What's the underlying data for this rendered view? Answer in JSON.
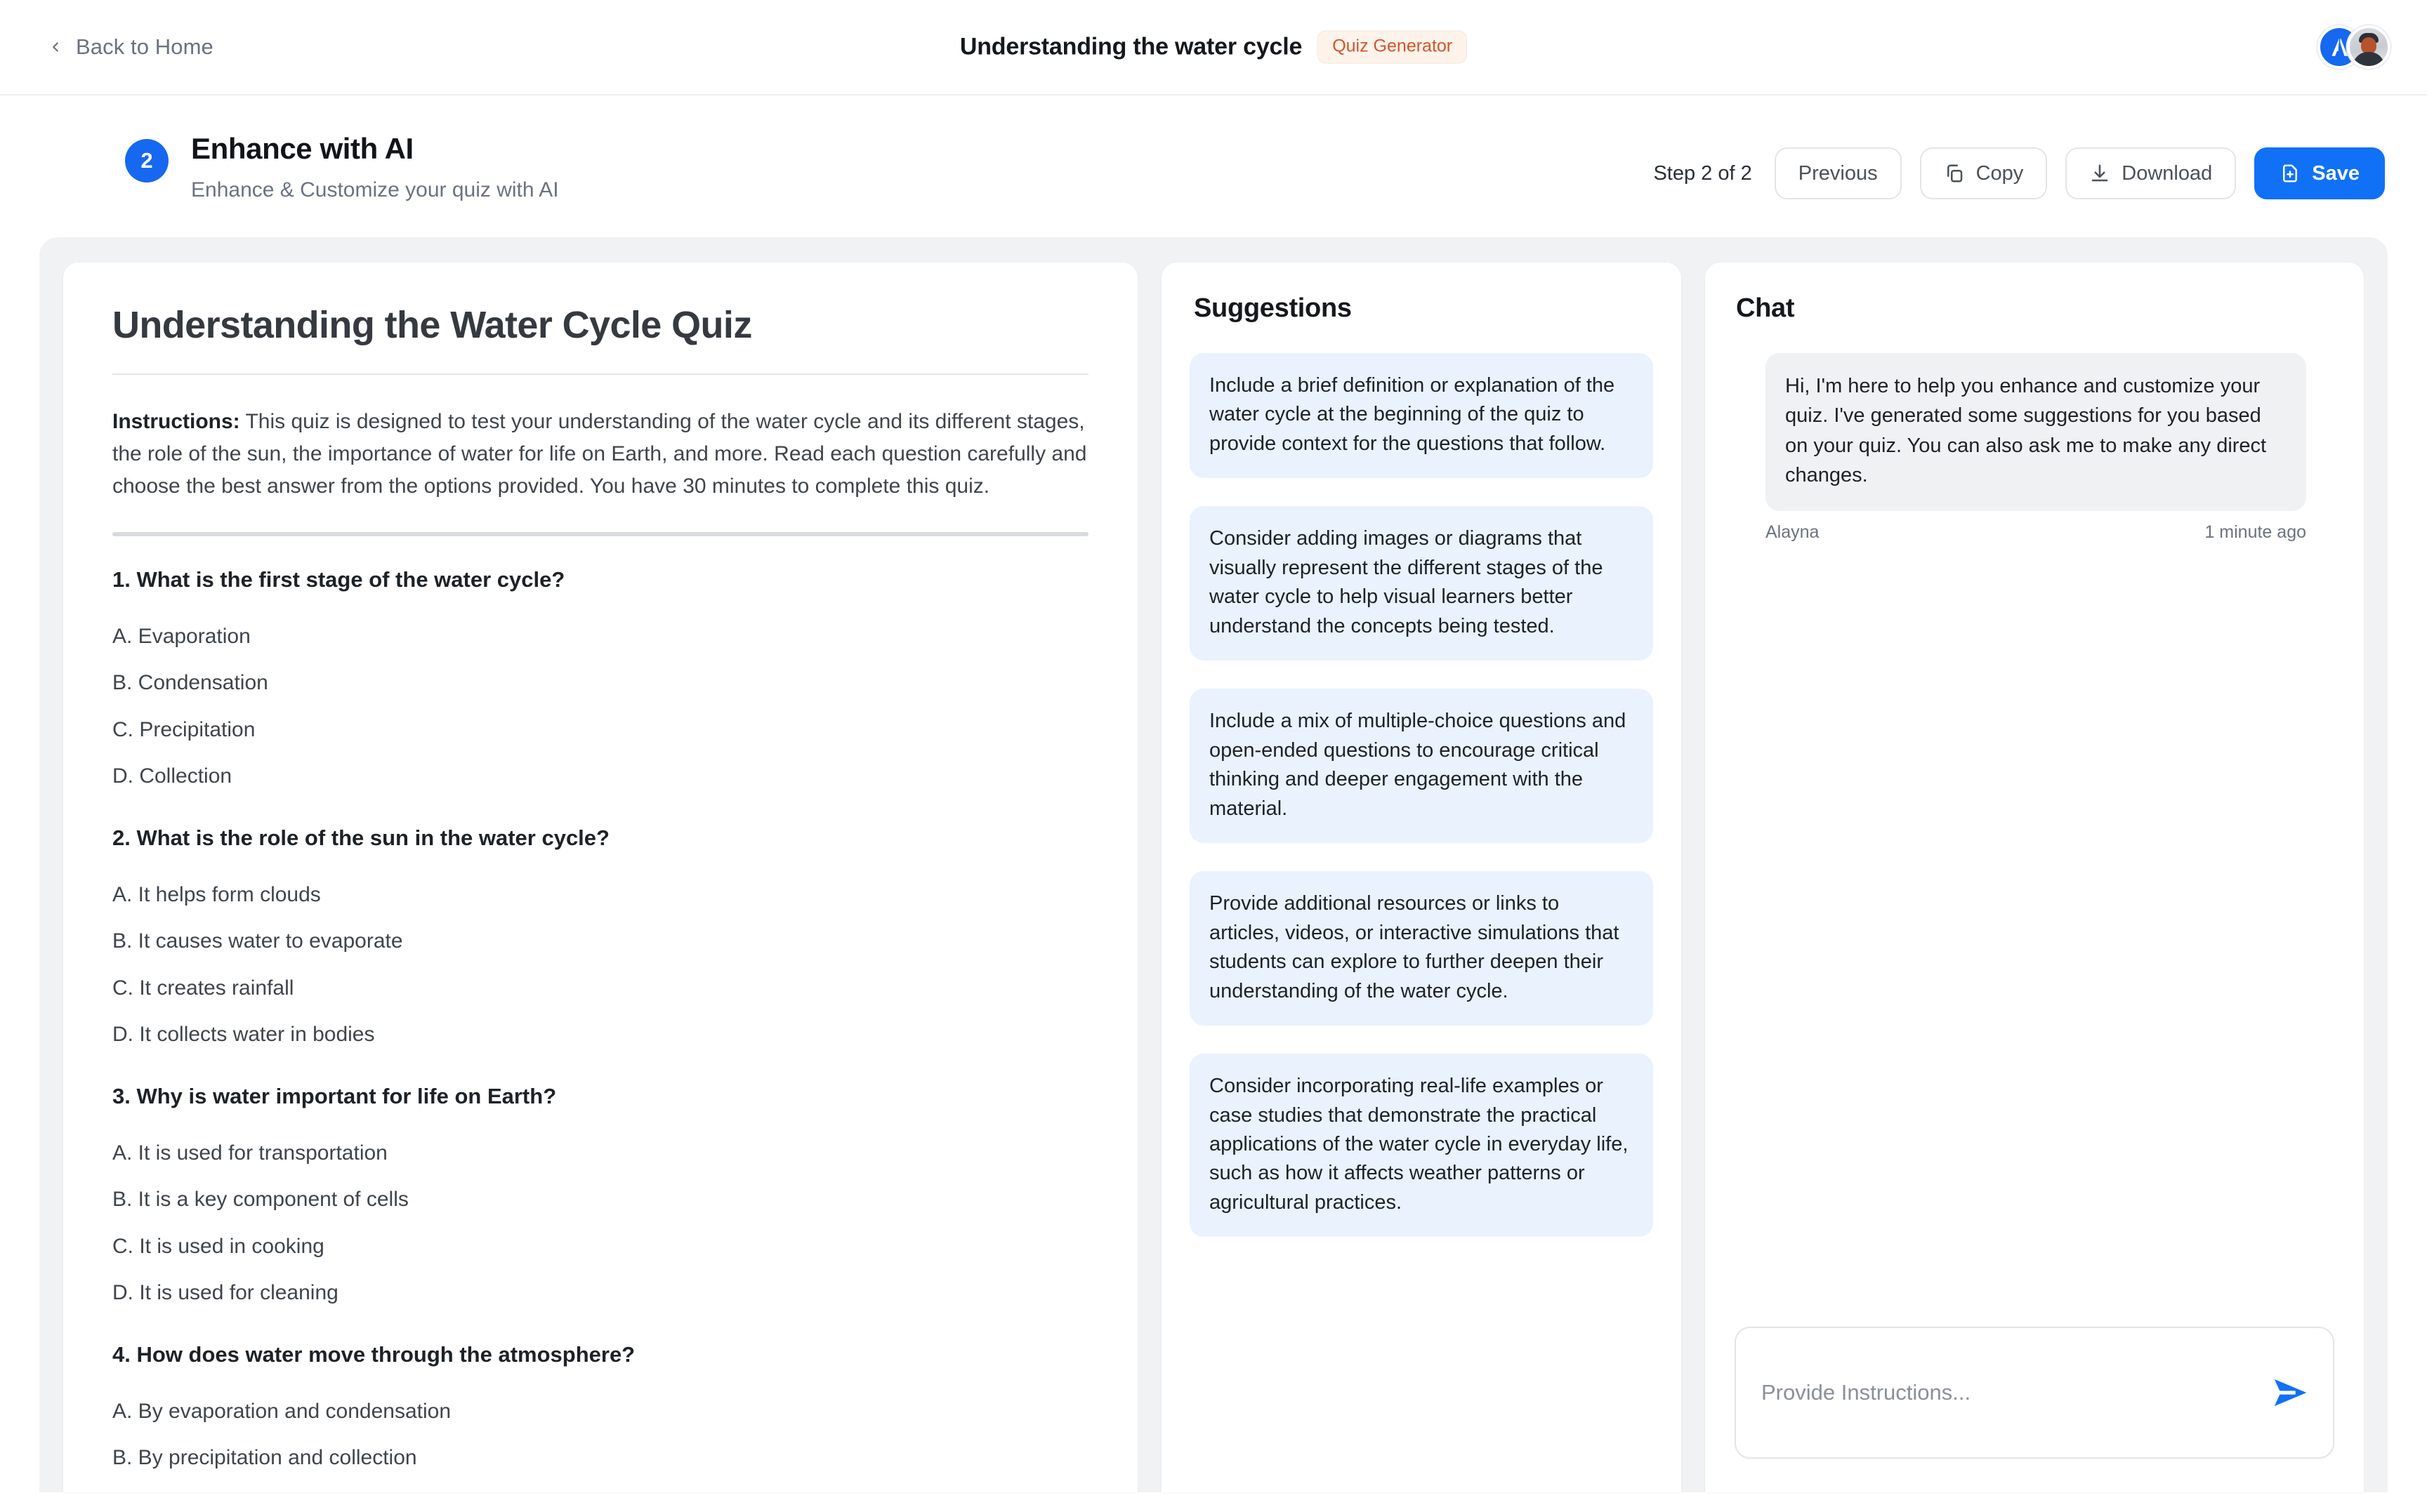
{
  "topbar": {
    "back_label": "Back to Home",
    "doc_title": "Understanding the water cycle",
    "badge_label": "Quiz Generator",
    "back_icon": "chevron-left-icon",
    "brand_avatar_icon": "brand-logo-icon",
    "user_avatar_icon": "user-photo-avatar"
  },
  "step": {
    "number": "2",
    "title": "Enhance with AI",
    "subtitle": "Enhance & Customize your quiz with AI",
    "counter": "Step 2 of 2"
  },
  "toolbar": {
    "previous_label": "Previous",
    "copy_label": "Copy",
    "download_label": "Download",
    "save_label": "Save",
    "copy_icon": "copy-icon",
    "download_icon": "download-icon",
    "save_icon": "file-plus-icon"
  },
  "document": {
    "title": "Understanding the Water Cycle Quiz",
    "instructions_label": "Instructions:",
    "instructions_text": " This quiz is designed to test your understanding of the water cycle and its different stages, the role of the sun, the importance of water for life on Earth, and more. Read each question carefully and choose the best answer from the options provided. You have 30 minutes to complete this quiz.",
    "questions": [
      {
        "prompt": "1. What is the first stage of the water cycle?",
        "options": [
          "A. Evaporation",
          "B. Condensation",
          "C. Precipitation",
          "D. Collection"
        ]
      },
      {
        "prompt": "2. What is the role of the sun in the water cycle?",
        "options": [
          "A. It helps form clouds",
          "B. It causes water to evaporate",
          "C. It creates rainfall",
          "D. It collects water in bodies"
        ]
      },
      {
        "prompt": "3. Why is water important for life on Earth?",
        "options": [
          "A. It is used for transportation",
          "B. It is a key component of cells",
          "C. It is used in cooking",
          "D. It is used for cleaning"
        ]
      },
      {
        "prompt": "4. How does water move through the atmosphere?",
        "options": [
          "A. By evaporation and condensation",
          "B. By precipitation and collection"
        ]
      }
    ]
  },
  "suggestions": {
    "heading": "Suggestions",
    "items": [
      "Include a brief definition or explanation of the water cycle at the beginning of the quiz to provide context for the questions that follow.",
      "Consider adding images or diagrams that visually represent the different stages of the water cycle to help visual learners better understand the concepts being tested.",
      "Include a mix of multiple-choice questions and open-ended questions to encourage critical thinking and deeper engagement with the material.",
      "Provide additional resources or links to articles, videos, or interactive simulations that students can explore to further deepen their understanding of the water cycle.",
      "Consider incorporating real-life examples or case studies that demonstrate the practical applications of the water cycle in everyday life, such as how it affects weather patterns or agricultural practices."
    ]
  },
  "chat": {
    "heading": "Chat",
    "message": "Hi, I'm here to help you enhance and customize your quiz. I've generated some suggestions for you based on your quiz. You can also ask me to make any direct changes.",
    "author": "Alayna",
    "timestamp": "1 minute ago",
    "input_placeholder": "Provide Instructions...",
    "input_value": "",
    "send_icon": "send-arrow-icon"
  },
  "colors": {
    "primary_blue": "#1071F7",
    "badge_text": "#D1562B",
    "badge_bg": "#FDF3EA",
    "suggestion_bg": "#E9F2FD",
    "chat_bubble_bg": "#F0F1F3",
    "workspace_bg": "#F1F2F4"
  }
}
